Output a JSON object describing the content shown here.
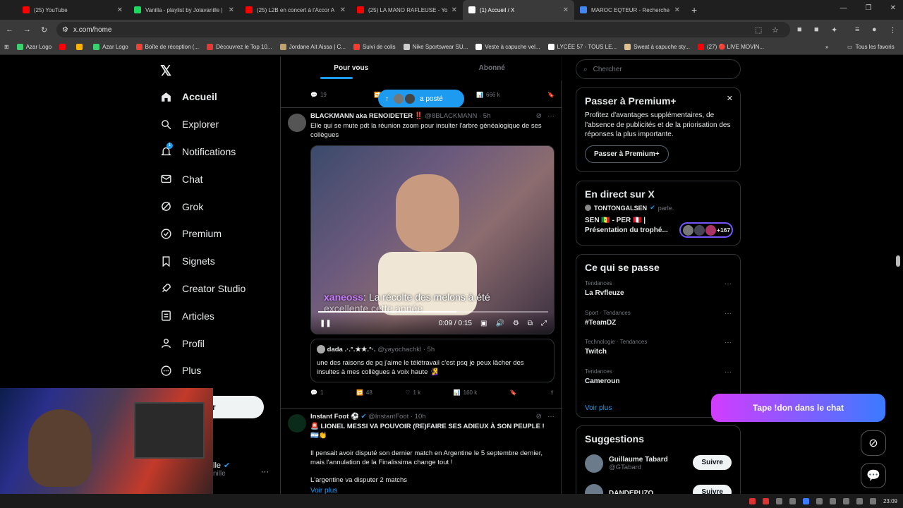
{
  "browser": {
    "tabs": [
      {
        "label": "(25) YouTube",
        "color": "#ff0000",
        "active": false
      },
      {
        "label": "Vanilla - playlist by Jolavanille |",
        "color": "#1ed760",
        "active": false
      },
      {
        "label": "(25) L2B en concert à l'Accor A",
        "color": "#ff0000",
        "active": false
      },
      {
        "label": "(25) LA MANO RAFLEUSE - You",
        "color": "#ff0000",
        "active": false
      },
      {
        "label": "(1) Accueil / X",
        "color": "#ffffff",
        "active": true
      },
      {
        "label": "MAROC EQTEUR - Recherche G",
        "color": "#4285f4",
        "active": false
      }
    ],
    "url": "x.com/home",
    "bookmarks": [
      {
        "label": "Azar Logo",
        "color": "#3bd16f"
      },
      {
        "label": "",
        "color": "#ff0000"
      },
      {
        "label": "",
        "color": "#ffb300"
      },
      {
        "label": "Azar Logo",
        "color": "#3bd16f"
      },
      {
        "label": "Boîte de réception (...",
        "color": "#ea4335"
      },
      {
        "label": "Découvrez le Top 10...",
        "color": "#e53935"
      },
      {
        "label": "Jordane Ait Aissa | C...",
        "color": "#bfa36a"
      },
      {
        "label": "Suivi de colis",
        "color": "#ff3b30"
      },
      {
        "label": "Nike Sportswear SU...",
        "color": "#cccccc"
      },
      {
        "label": "Veste à capuche vel...",
        "color": "#ffffff"
      },
      {
        "label": "LYCÉE 57 - TOUS LE...",
        "color": "#ffffff"
      },
      {
        "label": "Sweat à capuche sty...",
        "color": "#e0c08a"
      },
      {
        "label": "(27) 🔴 LIVE MOVIN...",
        "color": "#ff0000"
      }
    ],
    "all_bookmarks_label": "Tous les favoris"
  },
  "nav": {
    "items": [
      {
        "label": "Accueil",
        "icon": "home-icon"
      },
      {
        "label": "Explorer",
        "icon": "search-icon"
      },
      {
        "label": "Notifications",
        "icon": "bell-icon",
        "badge": "1"
      },
      {
        "label": "Chat",
        "icon": "mail-icon"
      },
      {
        "label": "Grok",
        "icon": "grok-icon"
      },
      {
        "label": "Premium",
        "icon": "verified-icon"
      },
      {
        "label": "Signets",
        "icon": "bookmark-icon"
      },
      {
        "label": "Creator Studio",
        "icon": "rocket-icon"
      },
      {
        "label": "Articles",
        "icon": "article-icon"
      },
      {
        "label": "Profil",
        "icon": "person-icon"
      },
      {
        "label": "Plus",
        "icon": "more-circle-icon"
      }
    ],
    "post_label": "ter",
    "profile_name": "lle",
    "profile_handle": "nille"
  },
  "feed": {
    "tabs": [
      "Pour vous",
      "Abonné"
    ],
    "partial_stats": {
      "replies": "19",
      "views": "666 k"
    },
    "new_posts_label": "a posté",
    "tweet1": {
      "name": "BLACKMANN aka RENOIDETER ‼️",
      "handle": "@8BLACKMANN",
      "time": "5h",
      "text": "Elle qui se mute pdt la réunion zoom pour insulter l'arbre généalogique de ses collègues",
      "video_subtitle_user": "xaneoss",
      "video_subtitle_text": ": La récolte des melons à été",
      "video_subtitle_line2": "excellente cette année",
      "video_time": "0:09 / 0:15",
      "quote_name": "dada .·.°.★★.°·.",
      "quote_handle": "@yayochachkl",
      "quote_time": "5h",
      "quote_text": "une des raisons de pq j'aime le télétravail c'est psq je peux lâcher des insultes à mes collègues à voix haute 🧏‍♀️",
      "stats": {
        "replies": "1",
        "reposts": "48",
        "likes": "1 k",
        "views": "160 k"
      }
    },
    "tweet2": {
      "name": "Instant Foot ⚽",
      "handle": "@InstantFoot",
      "time": "10h",
      "headline": "🚨 LIONEL MESSI VA POUVOIR (RE)FAIRE SES ADIEUX À SON PEUPLE ! 🇦🇷👏",
      "text": "Il pensait avoir disputé son dernier match en Argentine le 5 septembre dernier, mais l'annulation de la Finalissima change tout !",
      "text2": "L'argentine va disputer 2 matchs",
      "more": "Voir plus"
    }
  },
  "right": {
    "search_placeholder": "Chercher",
    "premium": {
      "title": "Passer à Premium+",
      "text": "Profitez d'avantages supplémentaires, de l'absence de publicités et de la priorisation des réponses la plus importante.",
      "button": "Passer à Premium+"
    },
    "live": {
      "title": "En direct sur X",
      "host": "TONTONGALSEN",
      "host_suffix": "parle.",
      "text": "SEN 🇸🇳 - PER 🇵🇪 | Présentation du trophé...",
      "count": "+167"
    },
    "trends": {
      "title": "Ce qui se passe",
      "items": [
        {
          "meta": "Tendances",
          "name": "La Rvfleuze"
        },
        {
          "meta": "Sport · Tendances",
          "name": "#TeamDZ"
        },
        {
          "meta": "Technologie · Tendances",
          "name": "Twitch"
        },
        {
          "meta": "Tendances",
          "name": "Cameroun"
        }
      ],
      "more": "Voir plus"
    },
    "suggestions": {
      "title": "Suggestions",
      "items": [
        {
          "name": "Guillaume Tabard",
          "handle": "@GTabard",
          "button": "Suivre"
        },
        {
          "name": "DANDEPUZO",
          "handle": "",
          "button": "Suivre"
        }
      ]
    }
  },
  "overlay": {
    "cta": "Tape !don dans le chat"
  },
  "taskbar": {
    "time": "23:09"
  }
}
